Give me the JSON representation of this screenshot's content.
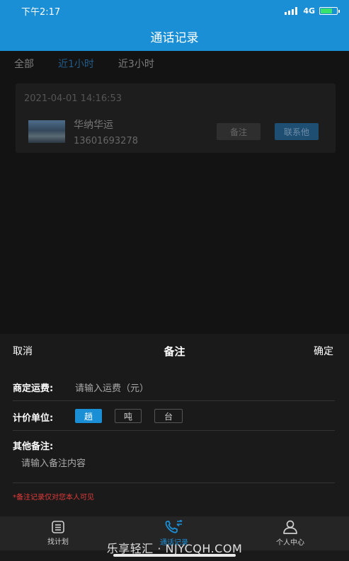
{
  "status_bar": {
    "time": "下午2:17",
    "network": "4G"
  },
  "header": {
    "title": "通话记录"
  },
  "filter_tabs": [
    {
      "label": "全部",
      "active": false
    },
    {
      "label": "近1小时",
      "active": true
    },
    {
      "label": "近3小时",
      "active": false
    }
  ],
  "call_record": {
    "time": "2021-04-01 14:16:53",
    "name": "华纳华运",
    "phone": "13601693278",
    "note_button": "备注",
    "contact_button": "联系他"
  },
  "note_sheet": {
    "cancel_label": "取消",
    "title": "备注",
    "confirm_label": "确定",
    "freight_label": "商定运费:",
    "freight_placeholder": "请输入运费（元）",
    "unit_label": "计价单位:",
    "units": [
      {
        "label": "趟",
        "selected": true
      },
      {
        "label": "吨",
        "selected": false
      },
      {
        "label": "台",
        "selected": false
      }
    ],
    "other_label": "其他备注:",
    "other_placeholder": "请输入备注内容",
    "tip": "*备注记录仅对您本人可见"
  },
  "bottom_tabs": [
    {
      "label": "找计划",
      "icon": "plan-icon",
      "active": false
    },
    {
      "label": "通话记录",
      "icon": "phone-call-icon",
      "active": true
    },
    {
      "label": "个人中心",
      "icon": "user-icon",
      "active": false
    }
  ],
  "watermark": "乐享轻汇 · NJYCQH.COM",
  "colors": {
    "primary": "#1b8fd6",
    "tip_red": "#e23a3a",
    "background": "#1a1a1a"
  }
}
